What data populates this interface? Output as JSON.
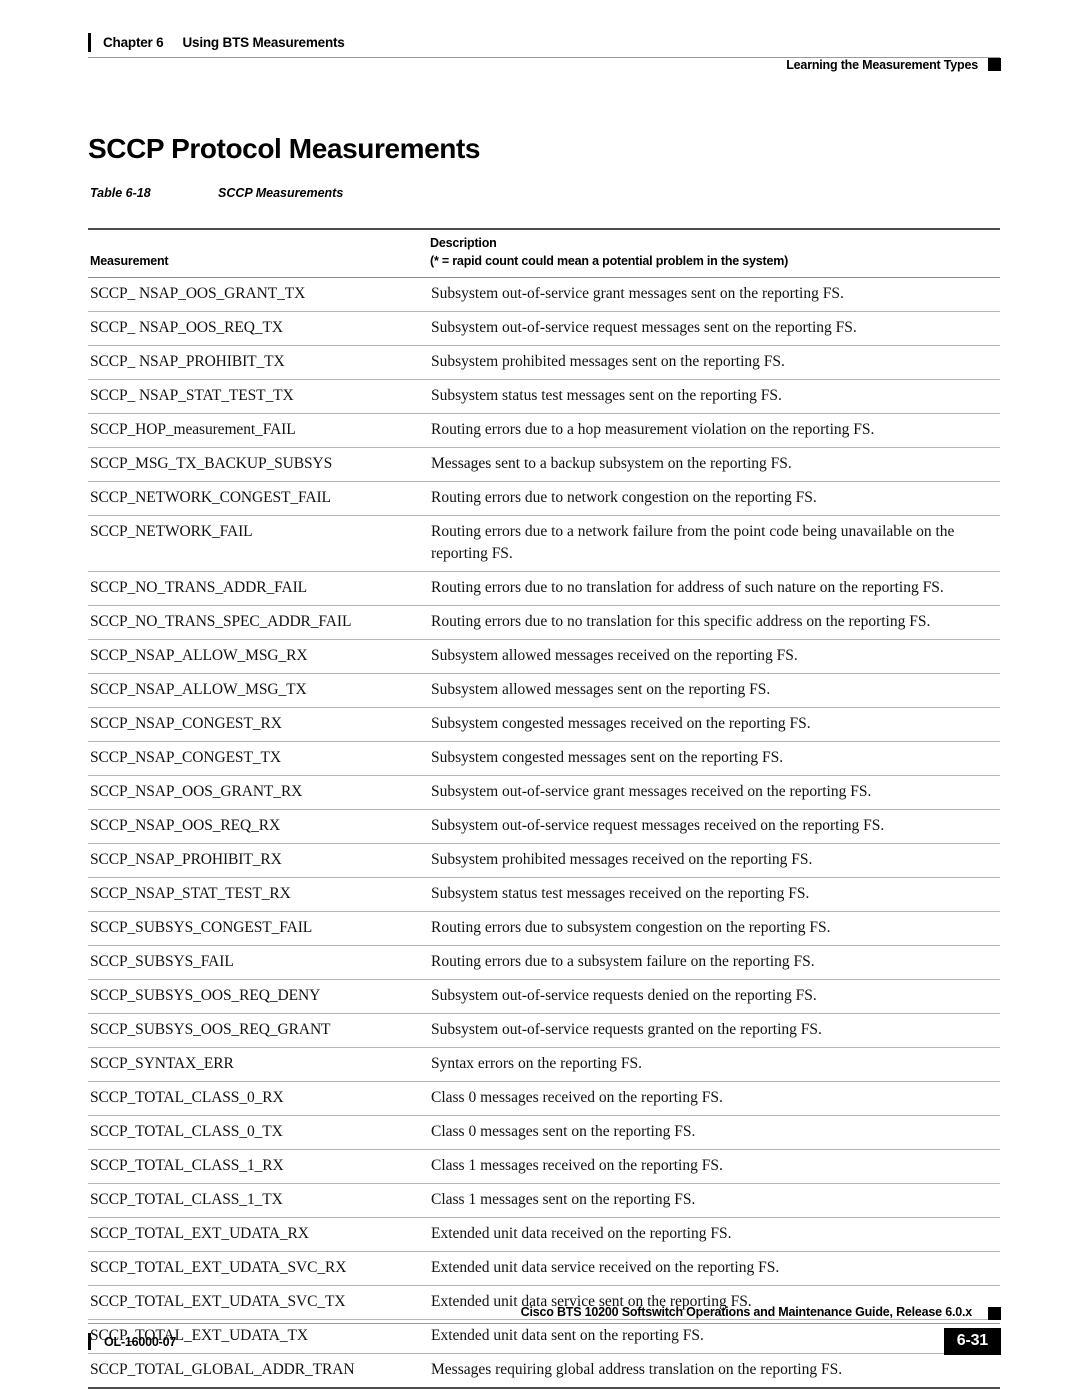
{
  "header": {
    "chapter_number": "Chapter 6",
    "chapter_title": "Using BTS Measurements",
    "section_title": "Learning the Measurement Types"
  },
  "title": "SCCP Protocol Measurements",
  "table_caption": {
    "number": "Table 6-18",
    "name": "SCCP Measurements"
  },
  "table": {
    "columns": {
      "measurement": "Measurement",
      "description_line1": "Description",
      "description_line2": "(* = rapid count could mean a potential problem in the system)"
    },
    "rows": [
      {
        "measurement": "SCCP_ NSAP_OOS_GRANT_TX",
        "description": "Subsystem out-of-service grant messages sent on the reporting FS."
      },
      {
        "measurement": "SCCP_ NSAP_OOS_REQ_TX",
        "description": "Subsystem out-of-service request messages sent on the reporting FS."
      },
      {
        "measurement": "SCCP_ NSAP_PROHIBIT_TX",
        "description": "Subsystem prohibited messages sent on the reporting FS."
      },
      {
        "measurement": "SCCP_ NSAP_STAT_TEST_TX",
        "description": "Subsystem status test messages sent on the reporting FS."
      },
      {
        "measurement": "SCCP_HOP_measurement_FAIL",
        "description": "Routing errors due to a hop measurement violation on the reporting FS."
      },
      {
        "measurement": "SCCP_MSG_TX_BACKUP_SUBSYS",
        "description": "Messages sent to a backup subsystem on the reporting FS."
      },
      {
        "measurement": "SCCP_NETWORK_CONGEST_FAIL",
        "description": "Routing errors due to network congestion on the reporting FS."
      },
      {
        "measurement": "SCCP_NETWORK_FAIL",
        "description": "Routing errors due to a network failure from the point code being unavailable on the reporting FS."
      },
      {
        "measurement": "SCCP_NO_TRANS_ADDR_FAIL",
        "description": "Routing errors due to no translation for address of such nature on the reporting FS."
      },
      {
        "measurement": "SCCP_NO_TRANS_SPEC_ADDR_FAIL",
        "description": "Routing errors due to no translation for this specific address on the reporting FS."
      },
      {
        "measurement": "SCCP_NSAP_ALLOW_MSG_RX",
        "description": "Subsystem allowed messages received on the reporting FS."
      },
      {
        "measurement": "SCCP_NSAP_ALLOW_MSG_TX",
        "description": "Subsystem allowed messages sent on the reporting FS."
      },
      {
        "measurement": "SCCP_NSAP_CONGEST_RX",
        "description": "Subsystem congested messages received on the reporting FS."
      },
      {
        "measurement": "SCCP_NSAP_CONGEST_TX",
        "description": "Subsystem congested messages sent on the reporting FS."
      },
      {
        "measurement": "SCCP_NSAP_OOS_GRANT_RX",
        "description": "Subsystem out-of-service grant messages received on the reporting FS."
      },
      {
        "measurement": "SCCP_NSAP_OOS_REQ_RX",
        "description": "Subsystem out-of-service request messages received on the reporting FS."
      },
      {
        "measurement": "SCCP_NSAP_PROHIBIT_RX",
        "description": "Subsystem prohibited messages received on the reporting FS."
      },
      {
        "measurement": "SCCP_NSAP_STAT_TEST_RX",
        "description": "Subsystem status test messages received on the reporting FS."
      },
      {
        "measurement": "SCCP_SUBSYS_CONGEST_FAIL",
        "description": "Routing errors due to subsystem congestion on the reporting FS."
      },
      {
        "measurement": "SCCP_SUBSYS_FAIL",
        "description": "Routing errors due to a subsystem failure on the reporting FS."
      },
      {
        "measurement": "SCCP_SUBSYS_OOS_REQ_DENY",
        "description": "Subsystem out-of-service requests denied on the reporting FS."
      },
      {
        "measurement": "SCCP_SUBSYS_OOS_REQ_GRANT",
        "description": "Subsystem out-of-service requests granted on the reporting FS."
      },
      {
        "measurement": "SCCP_SYNTAX_ERR",
        "description": "Syntax errors on the reporting FS."
      },
      {
        "measurement": "SCCP_TOTAL_CLASS_0_RX",
        "description": "Class 0 messages received on the reporting FS."
      },
      {
        "measurement": "SCCP_TOTAL_CLASS_0_TX",
        "description": "Class 0 messages sent on the reporting FS."
      },
      {
        "measurement": "SCCP_TOTAL_CLASS_1_RX",
        "description": "Class 1 messages received on the reporting FS."
      },
      {
        "measurement": "SCCP_TOTAL_CLASS_1_TX",
        "description": "Class 1 messages sent on the reporting FS."
      },
      {
        "measurement": "SCCP_TOTAL_EXT_UDATA_RX",
        "description": "Extended unit data received on the reporting FS."
      },
      {
        "measurement": "SCCP_TOTAL_EXT_UDATA_SVC_RX",
        "description": "Extended unit data service received on the reporting FS."
      },
      {
        "measurement": "SCCP_TOTAL_EXT_UDATA_SVC_TX",
        "description": "Extended unit data service sent on the reporting FS."
      },
      {
        "measurement": "SCCP_TOTAL_EXT_UDATA_TX",
        "description": "Extended unit data sent on the reporting FS."
      },
      {
        "measurement": "SCCP_TOTAL_GLOBAL_ADDR_TRAN",
        "description": "Messages requiring global address translation on the reporting FS."
      }
    ]
  },
  "footer": {
    "guide_title": "Cisco BTS 10200 Softswitch Operations and Maintenance Guide, Release 6.0.x",
    "doc_id": "OL-16000-07",
    "page_number": "6-31"
  }
}
